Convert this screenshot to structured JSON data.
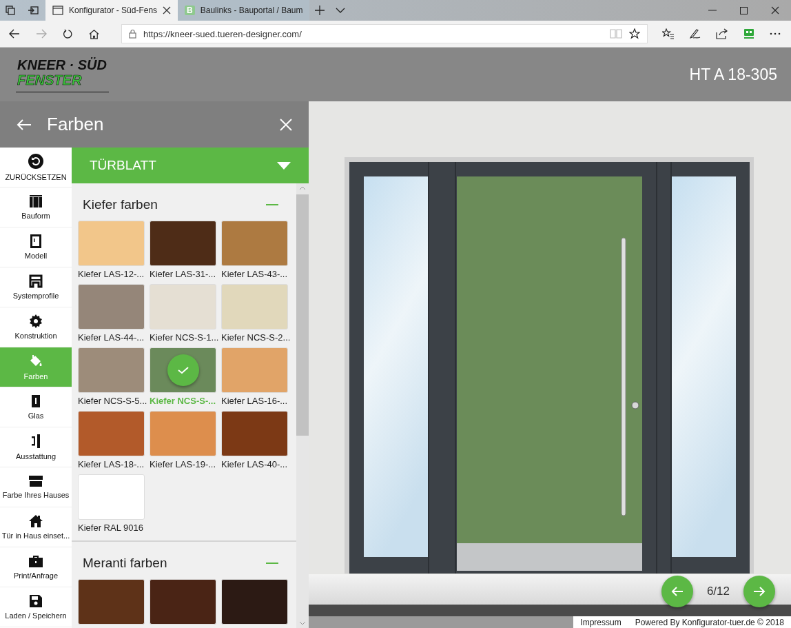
{
  "browser": {
    "tabs": [
      {
        "title": "Konfigurator - Süd-Fens",
        "selected": true,
        "kind": "page"
      },
      {
        "title": "Baulinks - Bauportal / Baum",
        "selected": false,
        "kind": "letter",
        "favicon_letter": "B"
      }
    ],
    "url": "https://kneer-sued.tueren-designer.com/"
  },
  "header": {
    "logo_top": "KNEER · SÜD",
    "logo_bottom": "FENSTER",
    "model": "HT A 18-305"
  },
  "panel": {
    "title": "Farben",
    "nav": [
      {
        "label": "ZURÜCKSETZEN",
        "kind": "reset",
        "selected": false
      },
      {
        "label": "Bauform",
        "kind": "shape",
        "selected": false
      },
      {
        "label": "Modell",
        "kind": "model",
        "selected": false
      },
      {
        "label": "Systemprofile",
        "kind": "profile",
        "selected": false
      },
      {
        "label": "Konstruktion",
        "kind": "gear",
        "selected": false
      },
      {
        "label": "Farben",
        "kind": "paint",
        "selected": true
      },
      {
        "label": "Glas",
        "kind": "glass",
        "selected": false
      },
      {
        "label": "Ausstattung",
        "kind": "fittings",
        "selected": false
      },
      {
        "label": "Farbe Ihres Hauses",
        "kind": "facade",
        "selected": false
      },
      {
        "label": "Tür in Haus einset...",
        "kind": "house",
        "selected": false
      },
      {
        "label": "Print/Anfrage",
        "kind": "case",
        "selected": false
      },
      {
        "label": "Laden / Speichern",
        "kind": "save",
        "selected": false
      }
    ],
    "dropdown": "TÜRBLATT",
    "groups": [
      {
        "title": "Kiefer farben",
        "expanded": true,
        "swatches": [
          {
            "label": "Kiefer LAS-12-...",
            "color": "#f2c68a",
            "selected": false
          },
          {
            "label": "Kiefer LAS-31-...",
            "color": "#4e2c17",
            "selected": false
          },
          {
            "label": "Kiefer LAS-43-...",
            "color": "#ad7a41",
            "selected": false
          },
          {
            "label": "Kiefer LAS-44-...",
            "color": "#958679",
            "selected": false
          },
          {
            "label": "Kiefer NCS-S-1...",
            "color": "#e5dfd3",
            "selected": false
          },
          {
            "label": "Kiefer NCS-S-2...",
            "color": "#e1d8bb",
            "selected": false
          },
          {
            "label": "Kiefer NCS-S-5...",
            "color": "#9d8c7a",
            "selected": false
          },
          {
            "label": "Kiefer NCS-S-...",
            "color": "#6b8a5b",
            "selected": true
          },
          {
            "label": "Kiefer LAS-16-...",
            "color": "#e1a468",
            "selected": false
          },
          {
            "label": "Kiefer LAS-18-...",
            "color": "#b25a2a",
            "selected": false
          },
          {
            "label": "Kiefer LAS-19-...",
            "color": "#dd8e4d",
            "selected": false
          },
          {
            "label": "Kiefer LAS-40-...",
            "color": "#7c3915",
            "selected": false
          },
          {
            "label": "Kiefer RAL 9016",
            "color": "#ffffff",
            "selected": false
          }
        ]
      },
      {
        "title": "Meranti farben",
        "expanded": true,
        "swatches": [
          {
            "color": "#5e3218",
            "selected": false
          },
          {
            "color": "#4a2415",
            "selected": false
          },
          {
            "color": "#2c1a14",
            "selected": false
          }
        ]
      }
    ]
  },
  "viewer": {
    "pager": "6/12",
    "footer_links": [
      "Impressum",
      "Powered By Konfigurator-tuer.de © 2018"
    ]
  }
}
